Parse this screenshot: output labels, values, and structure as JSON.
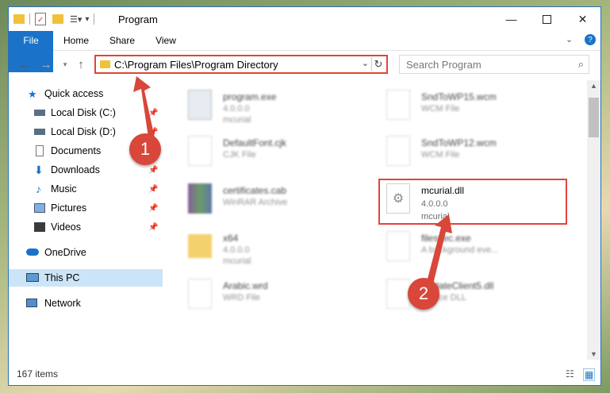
{
  "window": {
    "title": "Program"
  },
  "ribbon": {
    "tabs": [
      "File",
      "Home",
      "Share",
      "View"
    ]
  },
  "address": {
    "path": "C:\\Program Files\\Program Directory"
  },
  "search": {
    "placeholder": "Search Program"
  },
  "nav": {
    "items": [
      {
        "label": "Quick access",
        "icon": "star-icon"
      },
      {
        "label": "Local Disk (C:)",
        "icon": "drive-icon"
      },
      {
        "label": "Local Disk (D:)",
        "icon": "drive-icon"
      },
      {
        "label": "Documents",
        "icon": "documents-icon"
      },
      {
        "label": "Downloads",
        "icon": "download-icon"
      },
      {
        "label": "Music",
        "icon": "music-icon"
      },
      {
        "label": "Pictures",
        "icon": "pictures-icon"
      },
      {
        "label": "Videos",
        "icon": "videos-icon"
      },
      {
        "label": "OneDrive",
        "icon": "cloud-icon"
      },
      {
        "label": "This PC",
        "icon": "computer-icon"
      },
      {
        "label": "Network",
        "icon": "network-icon"
      }
    ]
  },
  "files": [
    {
      "name": "program.exe",
      "line2": "4.0.0.0",
      "line3": "mcurial"
    },
    {
      "name": "SndToWP15.wcm",
      "line2": "WCM File",
      "line3": ""
    },
    {
      "name": "DefaultFont.cjk",
      "line2": "CJK File",
      "line3": ""
    },
    {
      "name": "SndToWP12.wcm",
      "line2": "WCM File",
      "line3": ""
    },
    {
      "name": "certificates.cab",
      "line2": "WinRAR Archive",
      "line3": ""
    },
    {
      "name": "mcurial.dll",
      "line2": "4.0.0.0",
      "line3": "mcurial"
    },
    {
      "name": "x64",
      "line2": "4.0.0.0",
      "line3": "mcurial"
    },
    {
      "name": "filesvec.exe",
      "line2": "A background eve...",
      "line3": ""
    },
    {
      "name": "Arabic.wrd",
      "line2": "WRD File",
      "line3": ""
    },
    {
      "name": "UpdateClient5.dll",
      "line2": "Device DLL",
      "line3": ""
    }
  ],
  "status": {
    "items_count": "167 items"
  },
  "annotations": {
    "marker1": "1",
    "marker2": "2"
  },
  "colors": {
    "accent": "#1a73c8",
    "highlight": "#e0453b"
  }
}
